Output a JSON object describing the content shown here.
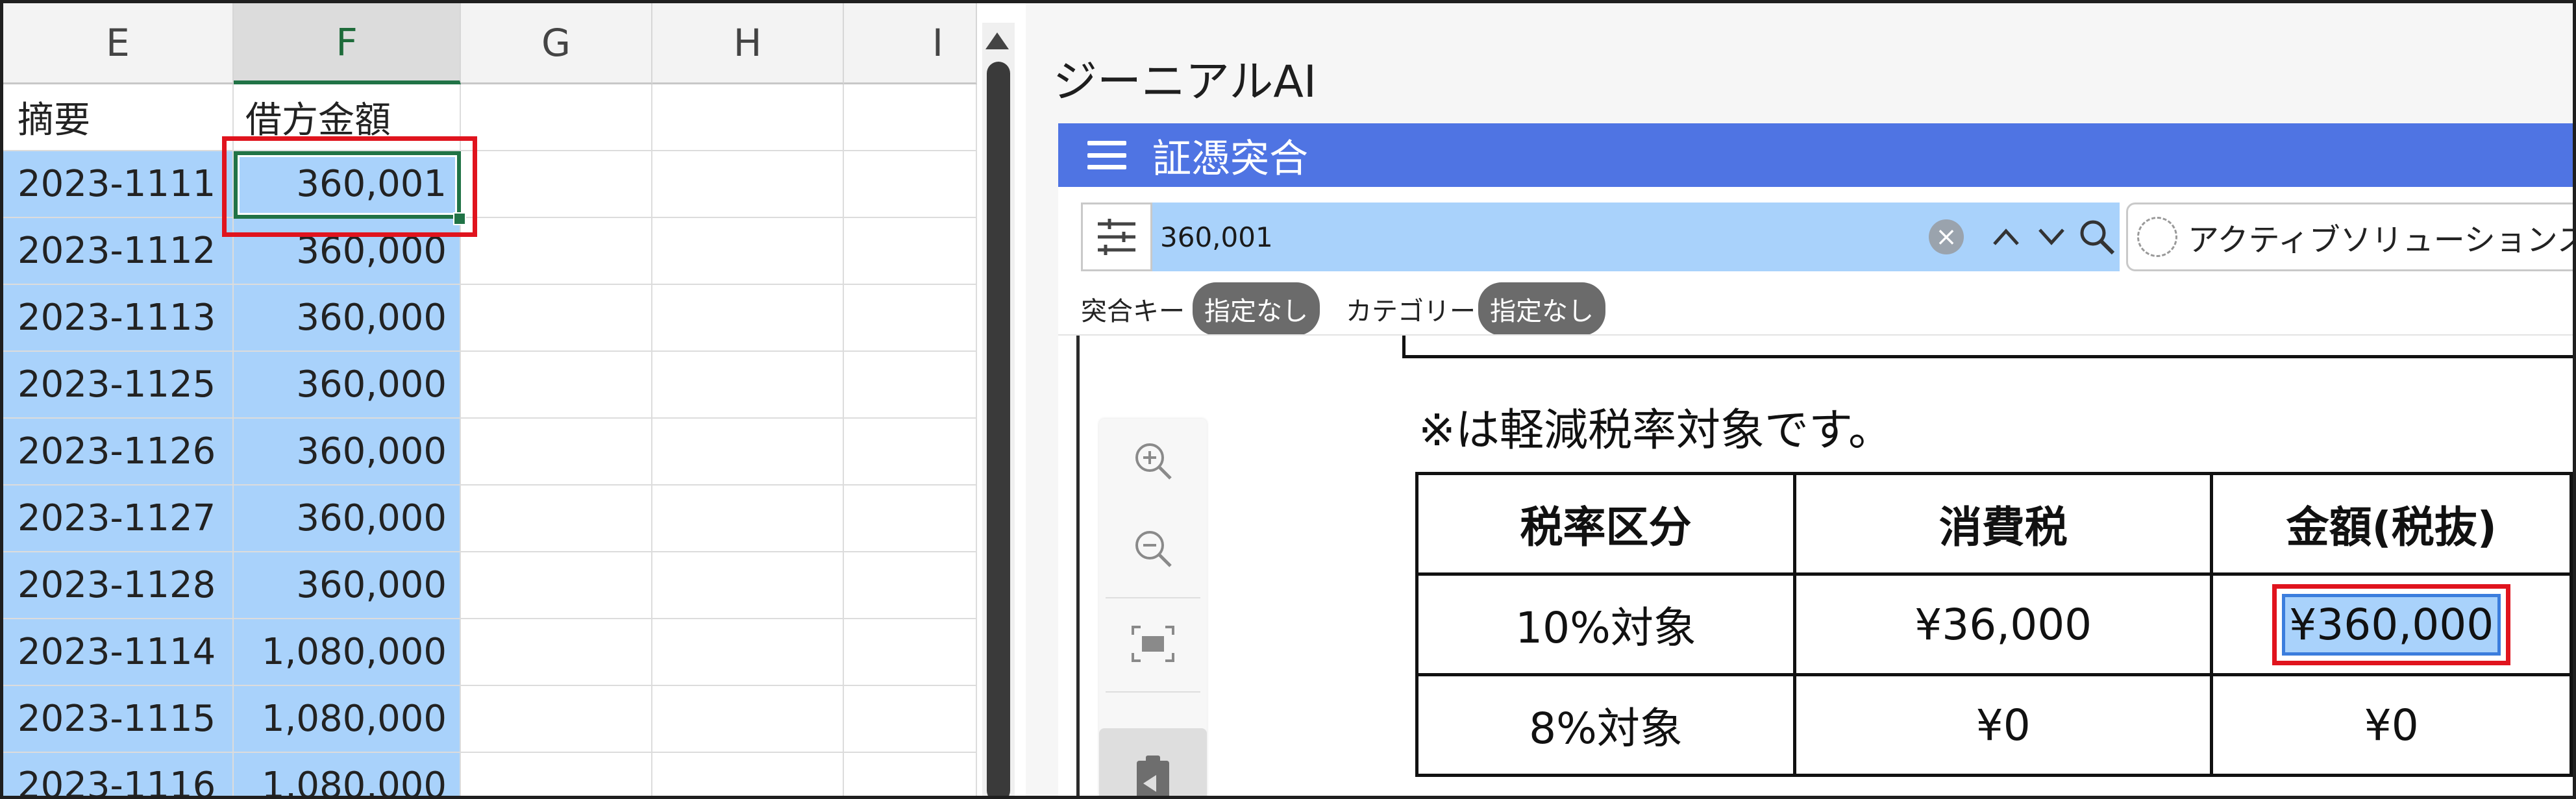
{
  "sheet": {
    "columns": [
      "E",
      "F",
      "G",
      "H",
      "I"
    ],
    "rows": [
      {
        "e": "摘要",
        "f": "借方金額"
      },
      {
        "e": "2023-1111",
        "f": "360,001"
      },
      {
        "e": "2023-1112",
        "f": "360,000"
      },
      {
        "e": "2023-1113",
        "f": "360,000"
      },
      {
        "e": "2023-1125",
        "f": "360,000"
      },
      {
        "e": "2023-1126",
        "f": "360,000"
      },
      {
        "e": "2023-1127",
        "f": "360,000"
      },
      {
        "e": "2023-1128",
        "f": "360,000"
      },
      {
        "e": "2023-1114",
        "f": "1,080,000"
      },
      {
        "e": "2023-1115",
        "f": "1,080,000"
      },
      {
        "e": "2023-1116",
        "f": "1,080,000"
      }
    ]
  },
  "app": {
    "title": "ジーニアルAI",
    "bar_title": "証憑突合",
    "search_value": "360,001",
    "solution_label": "アクティブソリューションス",
    "match_key_label": "突合キー",
    "match_key_value": "指定なし",
    "category_label": "カテゴリー",
    "category_value": "指定なし"
  },
  "document": {
    "note": "※は軽減税率対象です。",
    "headers": [
      "税率区分",
      "消費税",
      "金額(税抜)"
    ],
    "rows": [
      {
        "c1": "10%対象",
        "c2": "¥36,000",
        "c3": "¥360,000"
      },
      {
        "c1": "8%対象",
        "c2": "¥0",
        "c3": "¥0"
      }
    ]
  },
  "colors": {
    "selection": "#a9d2fb",
    "accent": "#4f74e3",
    "highlight": "#e0141e",
    "excel_green": "#217346"
  }
}
